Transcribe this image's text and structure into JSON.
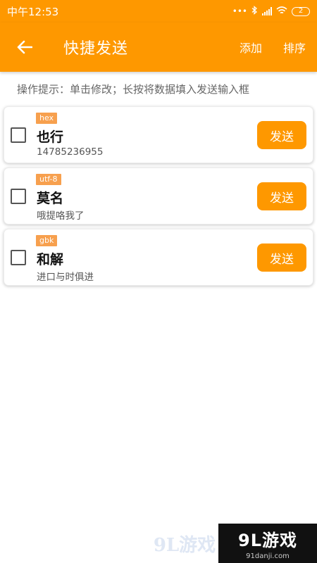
{
  "status_bar": {
    "time": "中午12:53",
    "dots": "•••",
    "battery": "2"
  },
  "app_bar": {
    "title": "快捷发送",
    "add_label": "添加",
    "sort_label": "排序"
  },
  "hint": "操作提示：单击修改；长按将数据填入发送输入框",
  "items": [
    {
      "encoding": "hex",
      "name": "也行",
      "data": "14785236955",
      "send_label": "发送"
    },
    {
      "encoding": "utf-8",
      "name": "莫名",
      "data": "哦提咯我了",
      "send_label": "发送"
    },
    {
      "encoding": "gbk",
      "name": "和解",
      "data": "进口与时俱进",
      "send_label": "发送"
    }
  ],
  "watermark": {
    "brand": "9L游戏",
    "site": "91danji.com"
  },
  "colors": {
    "accent": "#fe9800",
    "tag": "#f7a04e"
  }
}
